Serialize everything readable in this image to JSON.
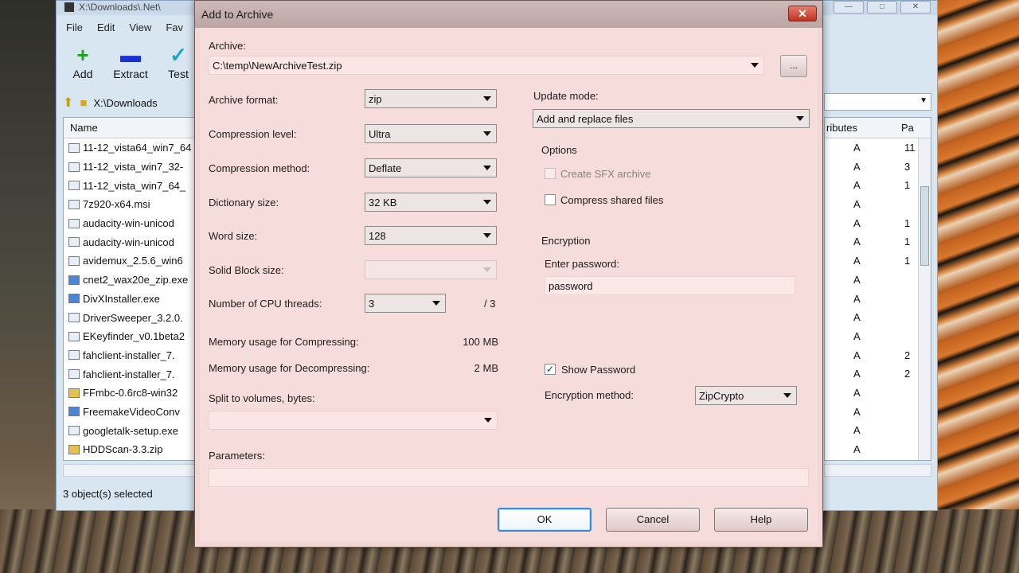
{
  "file_manager": {
    "title": "X:\\Downloads\\.Net\\",
    "menu": [
      "File",
      "Edit",
      "View",
      "Fav"
    ],
    "toolbar": [
      {
        "label": "Add",
        "icon": "plus-icon"
      },
      {
        "label": "Extract",
        "icon": "minus-icon"
      },
      {
        "label": "Test",
        "icon": "check-icon"
      }
    ],
    "address": "X:\\Downloads",
    "col_name": "Name",
    "col_attributes": "ributes",
    "col_packed": "Pa",
    "files": [
      "11-12_vista64_win7_64",
      "11-12_vista_win7_32-",
      "11-12_vista_win7_64_",
      "7z920-x64.msi",
      "audacity-win-unicod",
      "audacity-win-unicod",
      "avidemux_2.5.6_win6",
      "cnet2_wax20e_zip.exe",
      "DivXInstaller.exe",
      "DriverSweeper_3.2.0.",
      "EKeyfinder_v0.1beta2",
      "fahclient-installer_7.",
      "fahclient-installer_7.",
      "FFmbc-0.6rc8-win32",
      "FreemakeVideoConv",
      "googletalk-setup.exe",
      "HDDScan-3.3.zip"
    ],
    "attr_rows": [
      {
        "a": "A",
        "p": "11"
      },
      {
        "a": "A",
        "p": "3"
      },
      {
        "a": "A",
        "p": "1"
      },
      {
        "a": "A",
        "p": ""
      },
      {
        "a": "A",
        "p": "1"
      },
      {
        "a": "A",
        "p": "1"
      },
      {
        "a": "A",
        "p": "1"
      },
      {
        "a": "A",
        "p": ""
      },
      {
        "a": "A",
        "p": ""
      },
      {
        "a": "A",
        "p": ""
      },
      {
        "a": "A",
        "p": ""
      },
      {
        "a": "A",
        "p": "2"
      },
      {
        "a": "A",
        "p": "2"
      },
      {
        "a": "A",
        "p": ""
      },
      {
        "a": "A",
        "p": ""
      },
      {
        "a": "A",
        "p": ""
      },
      {
        "a": "A",
        "p": ""
      }
    ],
    "status": "3 object(s) selected"
  },
  "dialog": {
    "title": "Add to Archive",
    "close_label": "✕",
    "archive_label": "Archive:",
    "archive_value": "C:\\temp\\NewArchiveTest.zip",
    "browse_label": "...",
    "archive_format_label": "Archive format:",
    "archive_format": "zip",
    "compression_level_label": "Compression level:",
    "compression_level": "Ultra",
    "compression_method_label": "Compression method:",
    "compression_method": "Deflate",
    "dictionary_size_label": "Dictionary size:",
    "dictionary_size": "32 KB",
    "word_size_label": "Word size:",
    "word_size": "128",
    "solid_block_label": "Solid Block size:",
    "solid_block": "",
    "cpu_threads_label": "Number of CPU threads:",
    "cpu_threads": "3",
    "cpu_threads_max": "/ 3",
    "mem_compress_label": "Memory usage for Compressing:",
    "mem_compress": "100 MB",
    "mem_decompress_label": "Memory usage for Decompressing:",
    "mem_decompress": "2 MB",
    "split_label": "Split to volumes, bytes:",
    "split_value": "",
    "parameters_label": "Parameters:",
    "parameters_value": "",
    "update_mode_label": "Update mode:",
    "update_mode": "Add and replace files",
    "options_label": "Options",
    "create_sfx_label": "Create SFX archive",
    "create_sfx_checked": false,
    "compress_shared_label": "Compress shared files",
    "compress_shared_checked": false,
    "encryption_label": "Encryption",
    "enter_password_label": "Enter password:",
    "password_value": "password",
    "show_password_label": "Show Password",
    "show_password_checked": true,
    "encryption_method_label": "Encryption method:",
    "encryption_method": "ZipCrypto",
    "ok_label": "OK",
    "cancel_label": "Cancel",
    "help_label": "Help"
  },
  "colors": {
    "dialog_bg": "#f6dcda",
    "default_button_border": "#3b8ad9",
    "close_button": "#c2321e"
  }
}
